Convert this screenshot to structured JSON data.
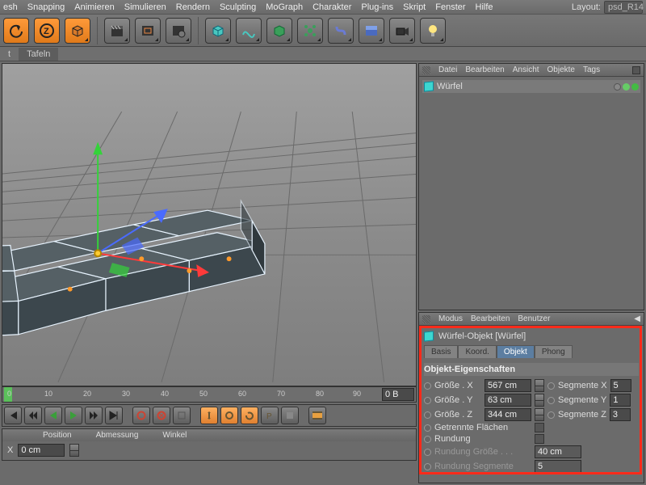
{
  "menu": {
    "items": [
      "esh",
      "Snapping",
      "Animieren",
      "Simulieren",
      "Rendern",
      "Sculpting",
      "MoGraph",
      "Charakter",
      "Plug-ins",
      "Skript",
      "Fenster",
      "Hilfe"
    ],
    "layout_label": "Layout:",
    "layout_value": "psd_R14"
  },
  "subtabs": {
    "items": [
      "t",
      "Tafeln"
    ]
  },
  "object_panel": {
    "menu": [
      "Datei",
      "Bearbeiten",
      "Ansicht",
      "Objekte",
      "Tags"
    ],
    "items": [
      {
        "name": "Würfel"
      }
    ]
  },
  "attr_panel": {
    "menu": [
      "Modus",
      "Bearbeiten",
      "Benutzer"
    ],
    "title": "Würfel-Objekt [Würfel]",
    "tabs": [
      "Basis",
      "Koord.",
      "Objekt",
      "Phong"
    ],
    "active_tab": "Objekt",
    "section": "Objekt-Eigenschaften",
    "size_x": {
      "label": "Größe . X",
      "value": "567 cm"
    },
    "size_y": {
      "label": "Größe . Y",
      "value": "63 cm"
    },
    "size_z": {
      "label": "Größe . Z",
      "value": "344 cm"
    },
    "seg_x": {
      "label": "Segmente X",
      "value": "5"
    },
    "seg_y": {
      "label": "Segmente Y",
      "value": "1"
    },
    "seg_z": {
      "label": "Segmente Z",
      "value": "3"
    },
    "separate": {
      "label": "Getrennte Flächen"
    },
    "rounding": {
      "label": "Rundung"
    },
    "round_size": {
      "label": "Rundung Größe . . .",
      "value": "40 cm"
    },
    "round_seg": {
      "label": "Rundung Segmente",
      "value": "5"
    }
  },
  "timeline": {
    "ticks": [
      0,
      10,
      20,
      30,
      40,
      50,
      60,
      70,
      80,
      90
    ],
    "frame_label": "0 B"
  },
  "coordbar": {
    "cols": [
      "Position",
      "Abmessung",
      "Winkel"
    ],
    "x_label": "X",
    "x_val": "0 cm"
  },
  "colors": {
    "accent": "#5c7ea1",
    "highlight": "#ff2a1a"
  },
  "chart_data": {
    "type": "table",
    "title": "Cube object dimensions and segmentation",
    "rows": [
      {
        "property": "Größe . X",
        "value": 567,
        "unit": "cm",
        "segments_label": "Segmente X",
        "segments": 5
      },
      {
        "property": "Größe . Y",
        "value": 63,
        "unit": "cm",
        "segments_label": "Segmente Y",
        "segments": 1
      },
      {
        "property": "Größe . Z",
        "value": 344,
        "unit": "cm",
        "segments_label": "Segmente Z",
        "segments": 3
      }
    ]
  }
}
